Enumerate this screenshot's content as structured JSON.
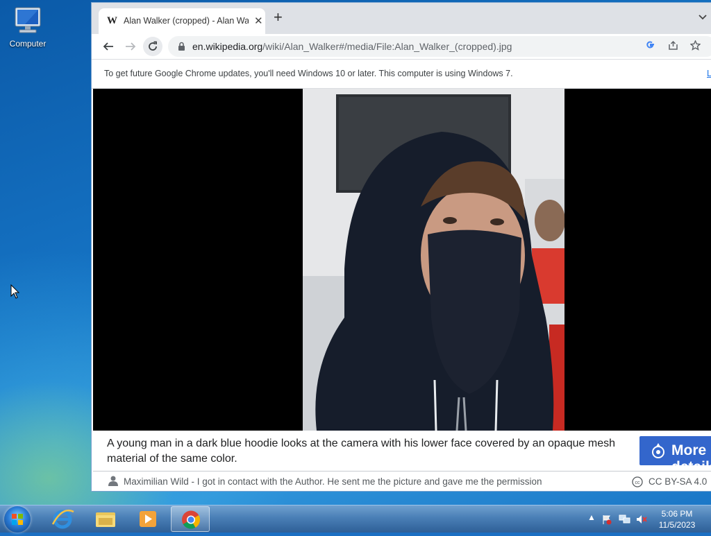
{
  "desktop": {
    "icons": [
      {
        "label": "Computer",
        "icon": "computer-icon"
      }
    ]
  },
  "browser": {
    "tab": {
      "favicon": "W",
      "title": "Alan Walker (cropped) - Alan Walker",
      "close": "✕"
    },
    "new_tab": "+",
    "tab_menu": "⌄",
    "url_host": "en.wikipedia.org",
    "url_path": "/wiki/Alan_Walker#/media/File:Alan_Walker_(cropped).jpg",
    "infobar": {
      "message": "To get future Google Chrome updates, you'll need Windows 10 or later. This computer is using Windows 7.",
      "link": "L"
    }
  },
  "media_viewer": {
    "caption": "A young man in a dark blue hoodie looks at the camera with his lower face covered by an opaque mesh material of the same color.",
    "more_button": "More details",
    "author": "Maximilian Wild - I got in contact with the Author. He sent me the picture and gave me the permission",
    "license": "CC BY-SA 4.0"
  },
  "taskbar": {
    "clock": {
      "time": "5:06 PM",
      "date": "11/5/2023"
    },
    "tray_arrow": "▲"
  },
  "colors": {
    "more_button": "#3366cc",
    "taskbar": "#2e5f97"
  }
}
